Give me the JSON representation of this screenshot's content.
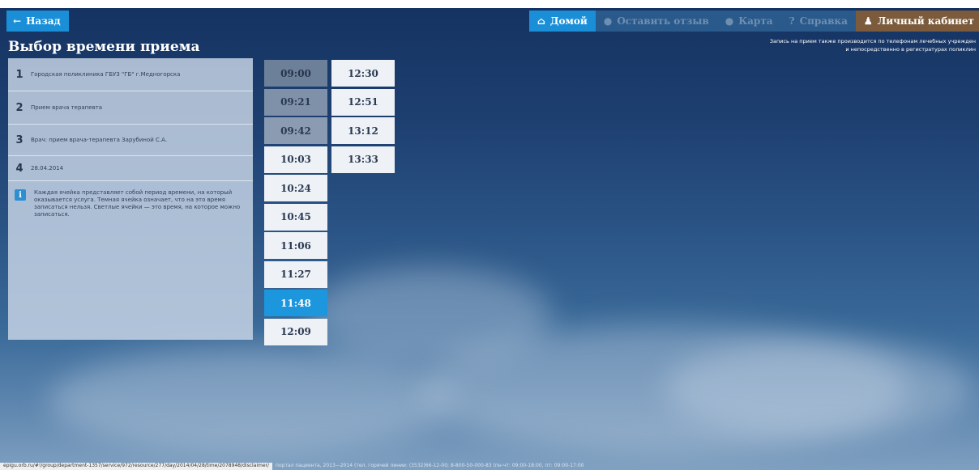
{
  "header": {
    "back_label": "Назад",
    "nav": {
      "home": "Домой",
      "review": "Оставить отзыв",
      "map": "Карта",
      "help": "Справка",
      "cabinet": "Личный кабинет"
    }
  },
  "page": {
    "title": "Выбор времени приема",
    "notice_line1": "Запись на прием также производится по телефонам лечебных учрежден",
    "notice_line2": "и непосредственно в регистратурах поликлин"
  },
  "steps": [
    {
      "num": "1",
      "text": "Городская поликлиника ГБУЗ \"ГБ\" г.Медногорска"
    },
    {
      "num": "2",
      "text": "Прием врача терапевта"
    },
    {
      "num": "3",
      "text": "Врач: прием врача-терапевта Зарубиной С.А."
    },
    {
      "num": "4",
      "text": "28.04.2014"
    }
  ],
  "info_text": "Каждая ячейка представляет собой период времени, на который оказывается услуга. Темная ячейка означает, что на это время записаться нельзя. Светлые ячейки — это время, на которое можно записаться.",
  "slots_col1": [
    "09:00",
    "09:21",
    "09:42",
    "10:03",
    "10:24",
    "10:45",
    "11:06",
    "11:27",
    "11:48",
    "12:09"
  ],
  "slots_col2": [
    "12:30",
    "12:51",
    "13:12",
    "13:33"
  ],
  "status": {
    "url": "epigu.orb.ru/#!/group/department-1357/service/972/resource/277/day/2014/04/28/time/2078948/disclaimer/",
    "footer": "портал пациента, 2013—2014 (тел. горячей линии: (3532)66-12-00; 8-800-50-000-83 (пн-чт: 09:00-18:00, пт: 09:00-17:00"
  },
  "colors": {
    "accent": "#1a8fd8",
    "selected_slot": "#1c96dd",
    "busy_slot": "#6d8099",
    "cabinet": "#7b5b3b"
  }
}
